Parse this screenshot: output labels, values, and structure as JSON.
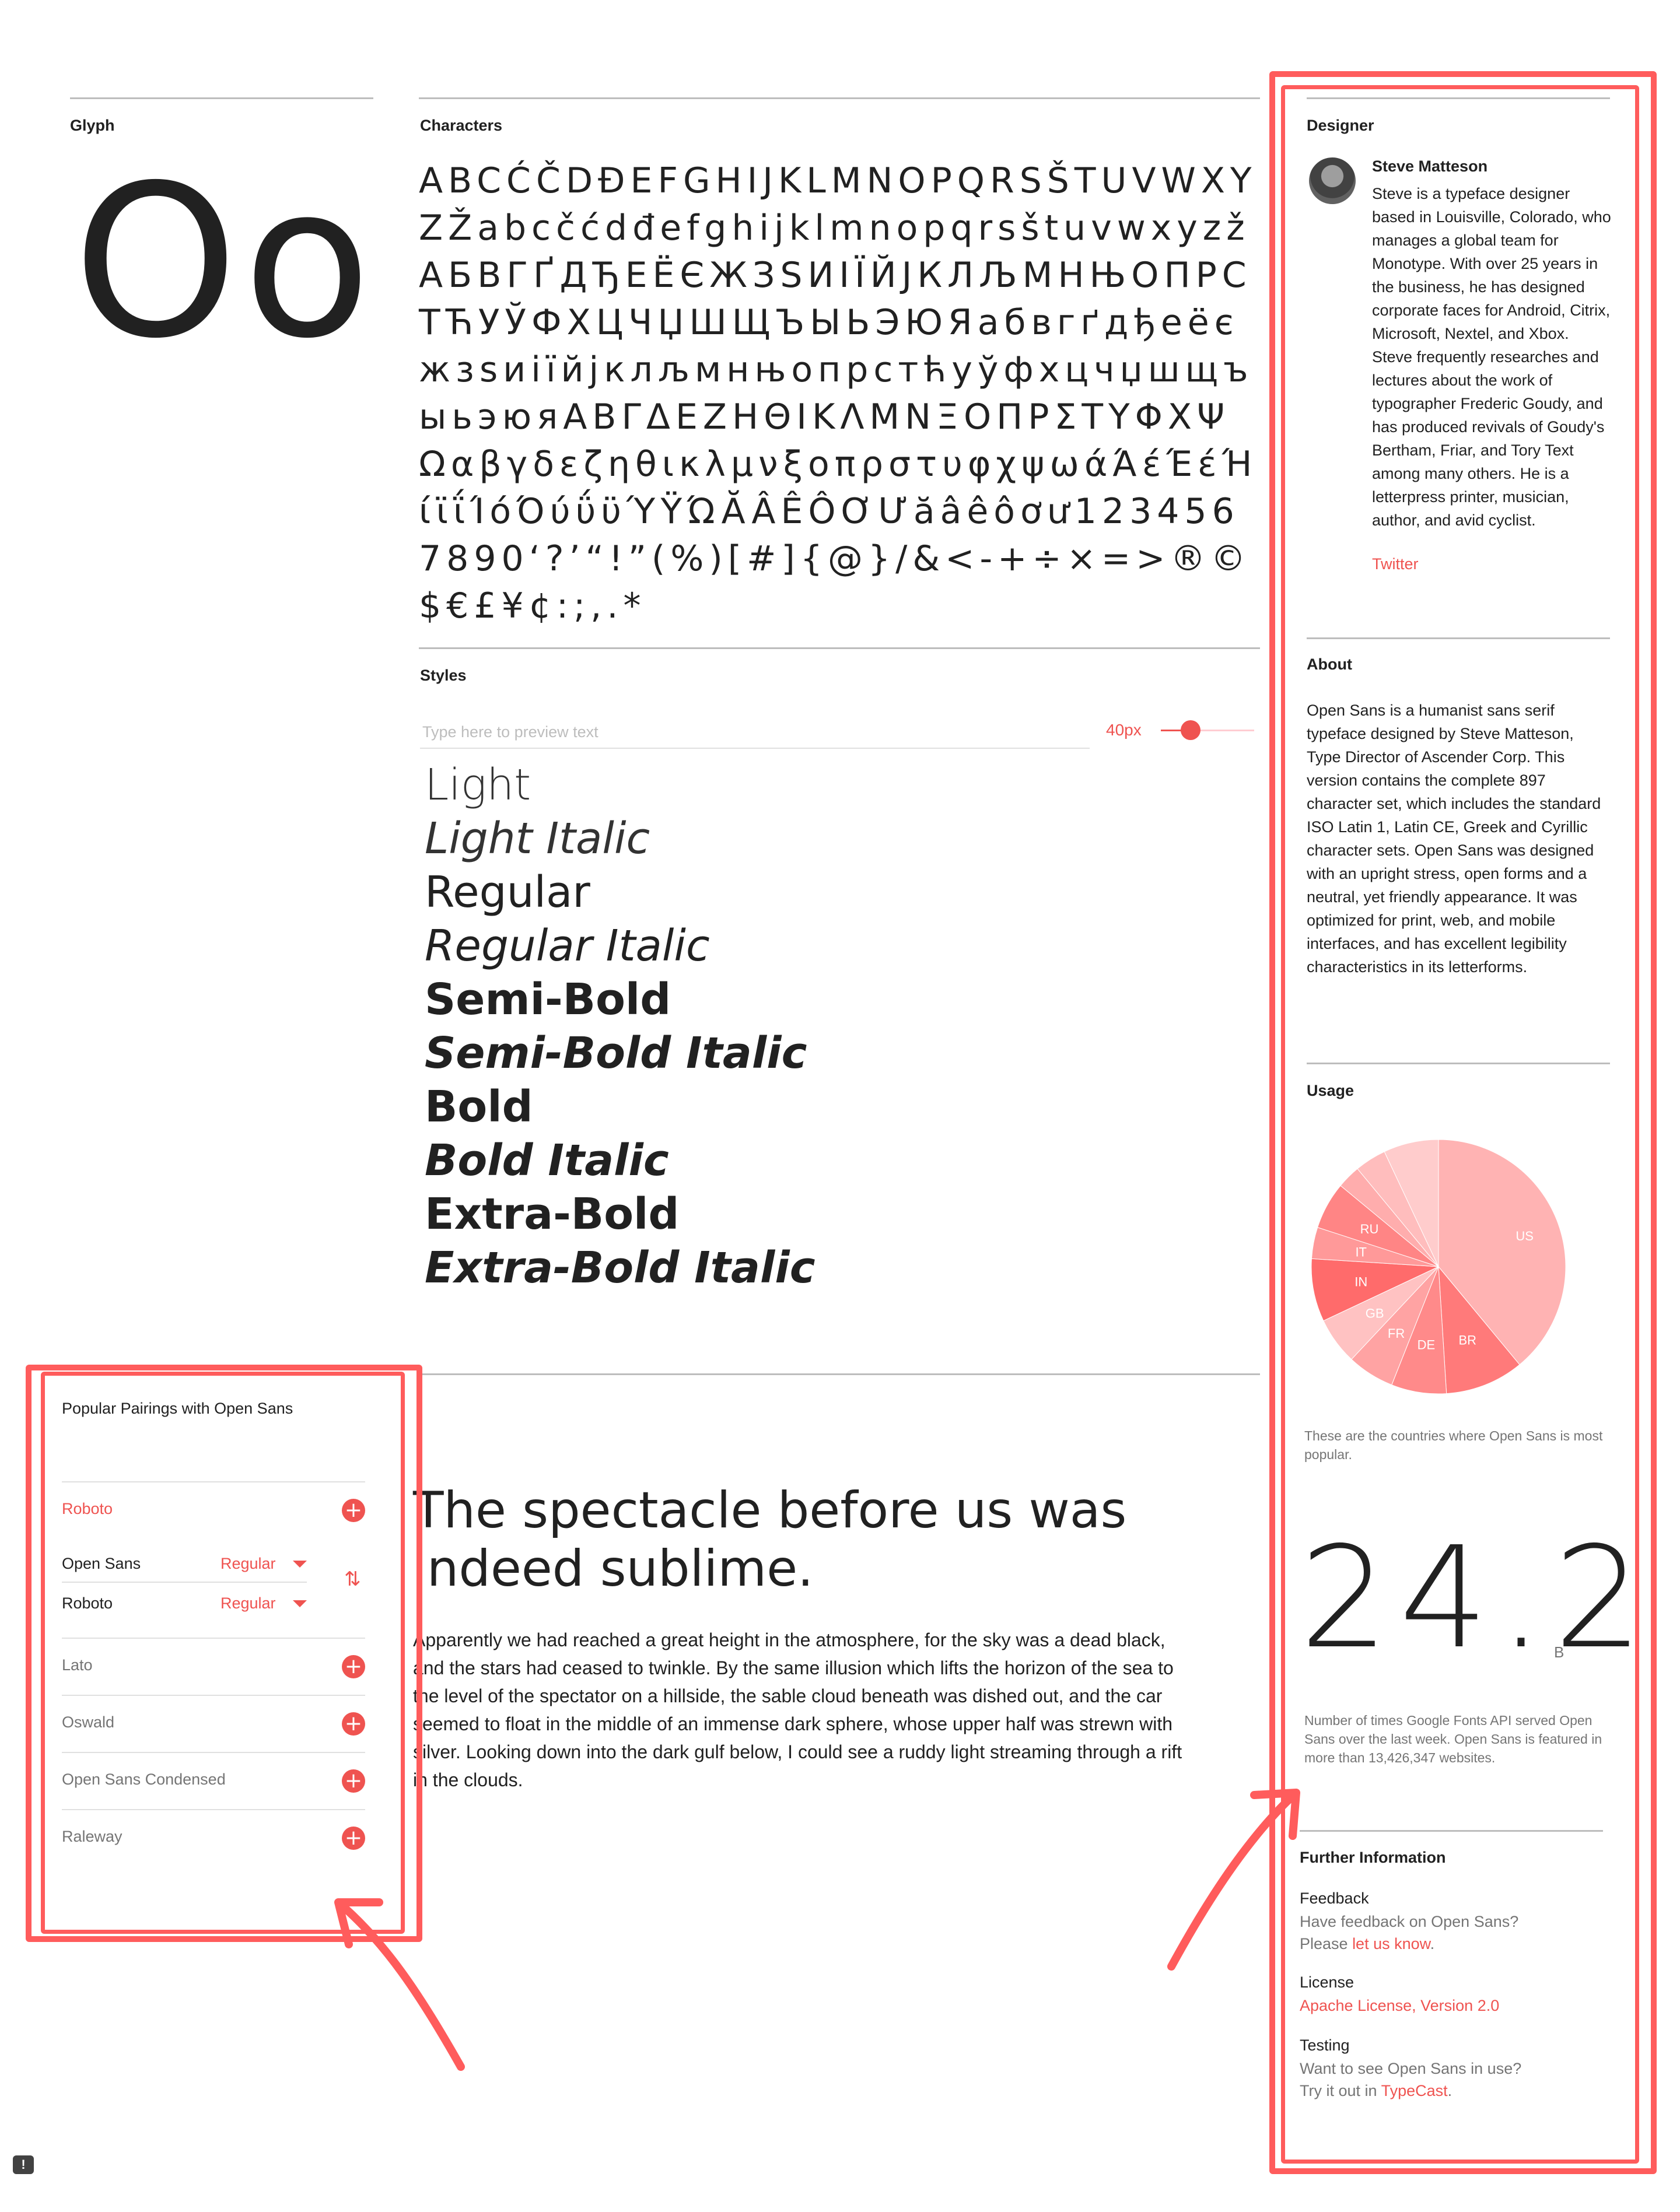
{
  "glyph": {
    "label": "Glyph",
    "sample": "Oo"
  },
  "characters": {
    "label": "Characters",
    "set": "ABCĆČDĐEFGHIJKLMNOPQRSŠTUVWXYZŽabcčćdđefghijklmnopqrsštuvwxyzžАБВГҐДЂЕЁЄЖЗЅИІЇЙЈКЛЉМНЊОПРСТЋУЎФХЦЧЏШЩЪЫЬЭЮЯабвгґдђеёєжзѕиіїйјклљмнњопрстћуўфхцчџшщъыьэюяΑΒΓΔΕΖΗΘΙΚΛΜΝΞΟΠΡΣΤΥΦΧΨΩαβγδεζηθικλμνξοπρστυφχψωάΆέΈέΉίϊΐΊόΌύΰϋΎΫΏĂÂÊÔƠƯăâêôơư1234567890‘?’“!”(%)[#]{@}/&<-+÷×=>®©$€£¥¢:;,.*"
  },
  "styles": {
    "label": "Styles",
    "preview_placeholder": "Type here to preview text",
    "size_label": "40px",
    "size_value_fraction": 0.22,
    "items": [
      "Light",
      "Light Italic",
      "Regular",
      "Regular Italic",
      "Semi-Bold",
      "Semi-Bold Italic",
      "Bold",
      "Bold Italic",
      "Extra-Bold",
      "Extra-Bold Italic"
    ]
  },
  "pairings": {
    "title": "Popular Pairings with Open Sans",
    "top_pair": {
      "name": "Roboto",
      "icon": "add-circle-icon"
    },
    "selected": [
      {
        "name": "Open Sans",
        "weight": "Regular"
      },
      {
        "name": "Roboto",
        "weight": "Regular"
      }
    ],
    "swap_icon": "swap-vertical-icon",
    "others": [
      "Lato",
      "Oswald",
      "Open Sans Condensed",
      "Raleway"
    ]
  },
  "sample": {
    "heading": "The spectacle before us was indeed sublime.",
    "body": "Apparently we had reached a great height in the atmosphere, for the sky was a dead black, and the stars had ceased to twinkle. By the same illusion which lifts the horizon of the sea to the level of the spectator on a hillside, the sable cloud beneath was dished out, and the car seemed to float in the middle of an immense dark sphere, whose upper half was strewn with silver. Looking down into the dark gulf below, I could see a ruddy light streaming through a rift in the clouds."
  },
  "designer": {
    "label": "Designer",
    "name": "Steve Matteson",
    "bio": "Steve is a typeface designer based in Louisville, Colorado, who manages a global team for Monotype. With over 25 years in the business, he has designed corporate faces for Android, Citrix, Microsoft, Nextel, and Xbox. Steve frequently researches and lectures about the work of typographer Frederic Goudy, and has produced revivals of Goudy's Bertham, Friar, and Tory Text among many others. He is a letterpress printer, musician, author, and avid cyclist.",
    "link": "Twitter"
  },
  "about": {
    "label": "About",
    "text": "Open Sans is a humanist sans serif typeface designed by Steve Matteson, Type Director of Ascender Corp. This version contains the complete 897 character set, which includes the standard ISO Latin 1, Latin CE, Greek and Cyrillic character sets. Open Sans was designed with an upright stress, open forms and a neutral, yet friendly appearance. It was optimized for print, web, and mobile interfaces, and has excellent legibility characteristics in its letterforms."
  },
  "usage": {
    "label": "Usage",
    "caption": "These are the countries where Open Sans is most popular.",
    "big_number": "24.2",
    "big_unit": "B",
    "served_caption": "Number of times Google Fonts API served Open Sans over the last week. Open Sans is featured in more than 13,426,347 websites."
  },
  "chart_data": {
    "type": "pie",
    "labels": [
      "US",
      "BR",
      "DE",
      "FR",
      "GB",
      "IN",
      "IT",
      "RU",
      "",
      "",
      ""
    ],
    "values": [
      39,
      10,
      7,
      6,
      6,
      8,
      4,
      6,
      3,
      4,
      7
    ],
    "colors": [
      "#ffb3b3",
      "#ff7a7a",
      "#ff8a8a",
      "#ffa3a3",
      "#ffc2c2",
      "#ff6b6b",
      "#ff9999",
      "#ff8585",
      "#ffadad",
      "#ffbdbd",
      "#ffcccc"
    ],
    "title": "",
    "legend": "none"
  },
  "further": {
    "label": "Further Information",
    "feedback_head": "Feedback",
    "feedback_line1": "Have feedback on Open Sans?",
    "feedback_line2_prefix": "Please ",
    "feedback_link": "let us know",
    "feedback_line2_suffix": ".",
    "license_head": "License",
    "license_link": "Apache License, Version 2.0",
    "testing_head": "Testing",
    "testing_line1": "Want to see Open Sans in use?",
    "testing_line2_prefix": "Try it out in ",
    "testing_link": "TypeCast",
    "testing_line2_suffix": "."
  },
  "feedback_icon": {
    "icon": "feedback-icon",
    "glyph": "!"
  }
}
